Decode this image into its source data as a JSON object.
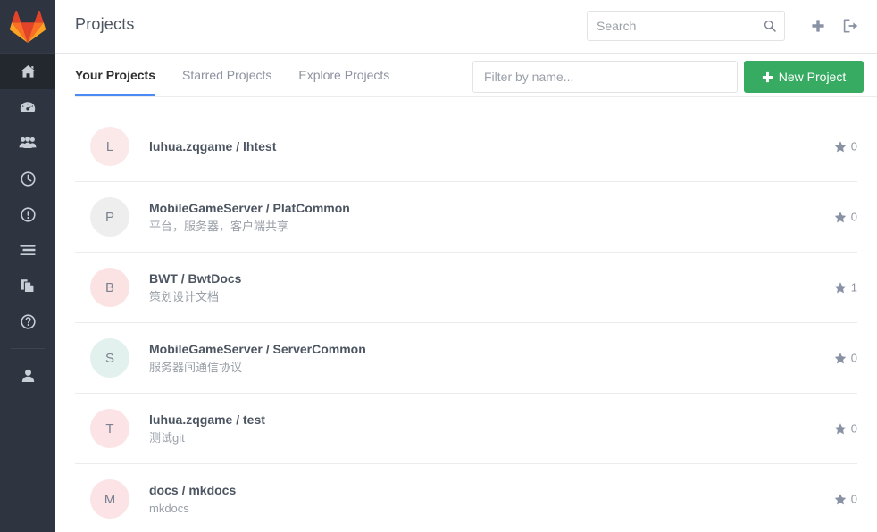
{
  "brand": {
    "logo_icon": "gitlab-tanuki-logo",
    "logo_colors": {
      "red": "#e24329",
      "orange": "#fc6d26",
      "amber": "#fca326"
    },
    "sidebar_bg": "#2e3440",
    "accent_blue": "#4a8bf5",
    "accent_green": "#37ab62"
  },
  "sidebar": {
    "items": [
      {
        "name": "home",
        "icon": "home-icon",
        "active": true
      },
      {
        "name": "dashboard",
        "icon": "dashboard-meter-icon",
        "active": false
      },
      {
        "name": "groups",
        "icon": "users-group-icon",
        "active": false
      },
      {
        "name": "activity",
        "icon": "clock-icon",
        "active": false
      },
      {
        "name": "issues",
        "icon": "exclamation-circle-icon",
        "active": false
      },
      {
        "name": "merge-requests",
        "icon": "list-bars-icon",
        "active": false
      },
      {
        "name": "snippets",
        "icon": "file-copy-icon",
        "active": false
      },
      {
        "name": "help",
        "icon": "question-circle-icon",
        "active": false
      }
    ],
    "bottom_items": [
      {
        "name": "profile",
        "icon": "user-icon",
        "active": false
      }
    ]
  },
  "header": {
    "title": "Projects",
    "search": {
      "placeholder": "Search",
      "value": "",
      "icon": "search-icon"
    },
    "new_icon": "plus-icon",
    "signout_icon": "sign-out-icon"
  },
  "tabsbar": {
    "tabs": [
      {
        "label": "Your Projects",
        "active": true
      },
      {
        "label": "Starred Projects",
        "active": false
      },
      {
        "label": "Explore Projects",
        "active": false
      }
    ],
    "filter": {
      "placeholder": "Filter by name...",
      "value": ""
    },
    "new_project": {
      "label": "New Project",
      "icon": "plus-icon"
    }
  },
  "projects": [
    {
      "avatar_letter": "L",
      "avatar_color": "#fbe9e9",
      "title": "luhua.zqgame / lhtest",
      "description": "",
      "stars": "0",
      "star_icon": "star-icon"
    },
    {
      "avatar_letter": "P",
      "avatar_color": "#eeeeee",
      "title": "MobileGameServer / PlatCommon",
      "description": "平台，服务器，客户端共享",
      "stars": "0",
      "star_icon": "star-icon"
    },
    {
      "avatar_letter": "B",
      "avatar_color": "#fbe3e3",
      "title": "BWT / BwtDocs",
      "description": "策划设计文档",
      "stars": "1",
      "star_icon": "star-icon"
    },
    {
      "avatar_letter": "S",
      "avatar_color": "#e2f1ee",
      "title": "MobileGameServer / ServerCommon",
      "description": "服务器间通信协议",
      "stars": "0",
      "star_icon": "star-icon"
    },
    {
      "avatar_letter": "T",
      "avatar_color": "#fbe3e6",
      "title": "luhua.zqgame / test",
      "description": "测试git",
      "stars": "0",
      "star_icon": "star-icon"
    },
    {
      "avatar_letter": "M",
      "avatar_color": "#fbe3e6",
      "title": "docs / mkdocs",
      "description": "mkdocs",
      "stars": "0",
      "star_icon": "star-icon"
    }
  ]
}
